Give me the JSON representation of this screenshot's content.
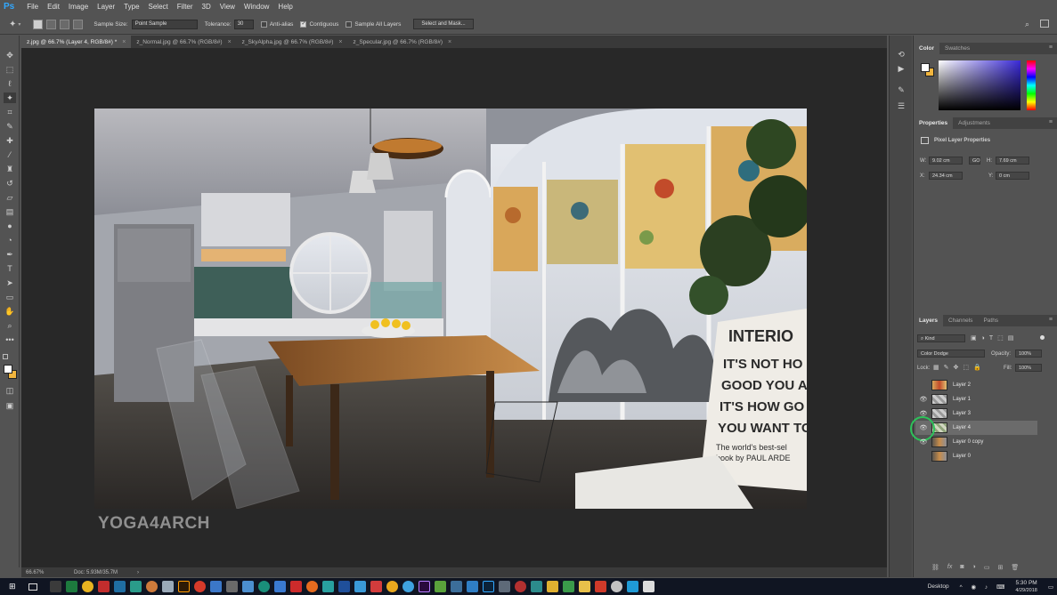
{
  "app": {
    "logo": "Ps",
    "menu": [
      "File",
      "Edit",
      "Image",
      "Layer",
      "Type",
      "Select",
      "Filter",
      "3D",
      "View",
      "Window",
      "Help"
    ]
  },
  "options": {
    "sample_size_label": "Sample Size:",
    "sample_size_value": "Point Sample",
    "tolerance_label": "Tolerance:",
    "tolerance_value": "30",
    "anti_alias_label": "Anti-alias",
    "contiguous_label": "Contiguous",
    "sample_all_layers_label": "Sample All Layers",
    "select_and_mask_label": "Select and Mask..."
  },
  "tabs": [
    {
      "label": "z.jpg @ 66.7% (Layer 4, RGB/8#) *",
      "active": true
    },
    {
      "label": "z_Normal.jpg @ 66.7% (RGB/8#)",
      "active": false
    },
    {
      "label": "z_SkyAlpha.jpg @ 66.7% (RGB/8#)",
      "active": false
    },
    {
      "label": "z_Specular.jpg @ 66.7% (RGB/8#)",
      "active": false
    }
  ],
  "tab_close": "×",
  "canvas": {
    "overlay_text": "YOGA4ARCH",
    "poster_lines": [
      "INTERIO",
      "IT'S NOT HO",
      "GOOD YOU A",
      "IT'S HOW GO",
      "YOU WANT TO",
      "The world's best-sel",
      "book by PAUL ARDE"
    ]
  },
  "status": {
    "zoom": "66.67%",
    "doc": "Doc: 5.93M/35.7M",
    "arrow": "›"
  },
  "color_panel": {
    "tabs": [
      "Color",
      "Swatches"
    ]
  },
  "properties_panel": {
    "tabs": [
      "Properties",
      "Adjustments"
    ],
    "heading": "Pixel Layer Properties",
    "w_label": "W:",
    "w_value": "9.02 cm",
    "h_label": "H:",
    "h_value": "7.69 cm",
    "x_label": "X:",
    "x_value": "24.34 cm",
    "y_label": "Y:",
    "y_value": "0 cm",
    "link_symbol": "GO"
  },
  "layers_panel": {
    "tabs": [
      "Layers",
      "Channels",
      "Paths"
    ],
    "filter_kind": "Kind",
    "blend_mode": "Color Dodge",
    "opacity_label": "Opacity:",
    "opacity_value": "100%",
    "lock_label": "Lock:",
    "fill_label": "Fill:",
    "fill_value": "100%",
    "layers": [
      {
        "name": "Layer 2",
        "visible": false,
        "selected": false
      },
      {
        "name": "Layer 1",
        "visible": true,
        "selected": false
      },
      {
        "name": "Layer 3",
        "visible": true,
        "selected": false
      },
      {
        "name": "Layer 4",
        "visible": true,
        "selected": true
      },
      {
        "name": "Layer 0 copy",
        "visible": true,
        "selected": false
      },
      {
        "name": "Layer 0",
        "visible": false,
        "selected": false
      }
    ],
    "bottom_icons": [
      "link-icon",
      "fx-icon",
      "mask-icon",
      "adjustment-icon",
      "folder-icon",
      "new-layer-icon",
      "trash-icon"
    ],
    "fx_label": "fx"
  },
  "taskbar": {
    "desktop_label": "Desktop",
    "time": "5:30 PM",
    "date": "4/29/2018"
  },
  "colors": {
    "accent": "#31a8ff",
    "panel_bg": "#535353",
    "canvas_bg": "#282828",
    "taskbar_bg": "#101522"
  }
}
